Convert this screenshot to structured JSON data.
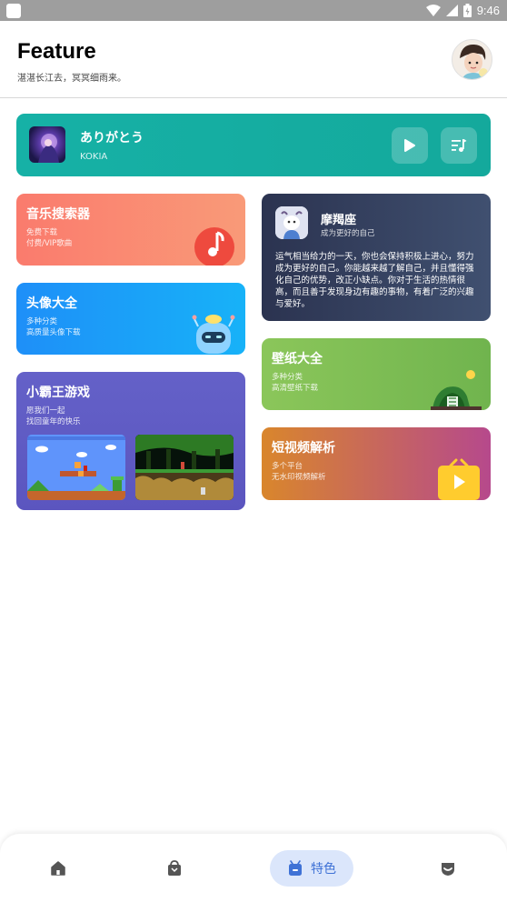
{
  "status_bar": {
    "time": "9:46"
  },
  "header": {
    "title": "Feature",
    "subtitle": "湛湛长江去，冥冥细雨来。"
  },
  "player": {
    "song_title": "ありがとう",
    "artist": "KOKIA",
    "accent": "#16b1a6"
  },
  "cards": {
    "music_search": {
      "title": "音乐搜索器",
      "line1": "免费下载",
      "line2": "付费/VIP歌曲"
    },
    "head_avatar": {
      "title": "头像大全",
      "line1": "多种分类",
      "line2": "高质量头像下载"
    },
    "games": {
      "title": "小霸王游戏",
      "line1": "愿我们一起",
      "line2": "找回童年的快乐"
    },
    "zodiac": {
      "title": "摩羯座",
      "subtitle": "成为更好的自己",
      "description": "运气相当给力的一天，你也会保持积极上进心，努力成为更好的自己。你能越来越了解自己，并且懂得强化自己的优势，改正小缺点。你对于生活的热情很高，而且善于发现身边有趣的事物，有着广泛的兴趣与爱好。"
    },
    "wallpaper": {
      "title": "壁纸大全",
      "line1": "多种分类",
      "line2": "高清壁纸下载"
    },
    "video_parse": {
      "title": "短视频解析",
      "line1": "多个平台",
      "line2": "无水印视频解析"
    }
  },
  "bottom_nav": {
    "items": [
      {
        "icon": "home-icon"
      },
      {
        "icon": "bag-icon"
      },
      {
        "icon": "feature-icon",
        "label": "特色",
        "active": true
      },
      {
        "icon": "shield-icon"
      }
    ],
    "active_color": "#3f72d6"
  }
}
